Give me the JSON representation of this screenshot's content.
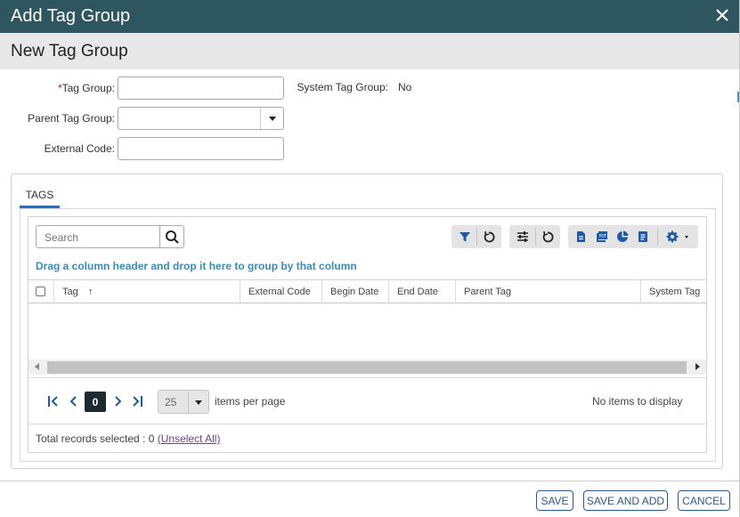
{
  "dialog": {
    "title": "Add Tag Group",
    "close_icon": "close-icon"
  },
  "header": {
    "title": "New Tag Group"
  },
  "form": {
    "tag_group_required_mark": "*",
    "tag_group_label": "Tag Group:",
    "tag_group_value": "",
    "parent_tag_group_label": "Parent Tag Group:",
    "parent_tag_group_value": "",
    "external_code_label": "External Code:",
    "external_code_value": "",
    "system_tag_group_label": "System Tag Group:",
    "system_tag_group_value": "No"
  },
  "tabs": [
    {
      "label": "TAGS",
      "active": true
    }
  ],
  "grid": {
    "search_placeholder": "Search",
    "group_hint": "Drag a column header and drop it here to group by that column",
    "columns": [
      "Tag",
      "External Code",
      "Begin Date",
      "End Date",
      "Parent Tag",
      "System Tag"
    ],
    "sort_indicator": "↑",
    "rows": [],
    "toolbar_icons": [
      "filter-icon",
      "reset-icon",
      "column-settings-icon",
      "reset-icon",
      "excel-export-icon",
      "pdf-export-icon",
      "chart-icon",
      "report-icon",
      "gear-icon"
    ]
  },
  "pager": {
    "current_page": "0",
    "page_size": "25",
    "items_per_page_label": "items per page",
    "no_items_label": "No items to display"
  },
  "selection": {
    "total_label": "Total records selected : 0",
    "unselect_all": "(Unselect All)"
  },
  "actions": {
    "save": "SAVE",
    "save_and_add": "SAVE AND ADD",
    "cancel": "CANCEL"
  },
  "colors": {
    "titlebar": "#2d5661",
    "accent": "#2a6bbf",
    "hint": "#3a8bb8",
    "required": "#c8102e"
  }
}
